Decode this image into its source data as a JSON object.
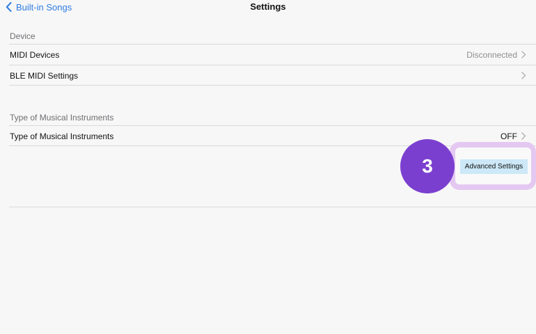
{
  "navbar": {
    "back_label": "Built-in Songs",
    "title": "Settings"
  },
  "sections": {
    "device": {
      "header": "Device",
      "midi_devices": {
        "label": "MIDI Devices",
        "value": "Disconnected"
      },
      "ble_midi": {
        "label": "BLE MIDI Settings"
      }
    },
    "instruments": {
      "header": "Type of Musical Instruments",
      "type_row": {
        "label": "Type of Musical Instruments",
        "value": "OFF"
      }
    }
  },
  "callout": {
    "step_number": "3",
    "button_label": "Advanced Settings"
  },
  "colors": {
    "accent": "#2f7de1",
    "badge": "#7b3fcf",
    "highlight": "#e4c8f1",
    "button_bg": "#cde8f7"
  },
  "icons": {
    "back": "chevron-left-icon",
    "disclosure": "chevron-right-icon"
  }
}
